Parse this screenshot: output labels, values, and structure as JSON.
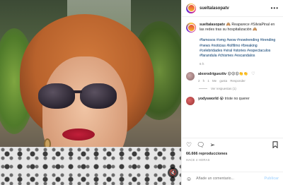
{
  "post": {
    "username": "sueltalasopatv",
    "caption_text": "🙈 Reaparece #SilviaPinal en las redes tras su hospitalización 🙈",
    "hashtags": "#famosos #omg #wow #nowtrending #trending #news #noticias #lolfilmo #breaking #celebridades #viral #stories #espectaculos #farandula #chismes #escandalos",
    "age": "6 h"
  },
  "comments": [
    {
      "username": "alexrodriguezttv",
      "text": "😍😍😍👏👏",
      "age": "2 h",
      "likes": "1 Me gusta",
      "reply": "Responder",
      "replies_label": "Ver respuestas (1)"
    },
    {
      "username": "yodysworld",
      "text": "😭 triste no querer"
    }
  ],
  "stats": {
    "views": "66.666 reproducciones",
    "time_ago": "HACE 4 HORAS"
  },
  "add_comment": {
    "placeholder": "Añade un comentario...",
    "publish_label": "Publicar"
  },
  "icons": {
    "more": "more-options-icon",
    "heart": "heart-icon",
    "comment": "comment-icon",
    "share": "share-icon",
    "bookmark": "bookmark-icon",
    "emoji": "emoji-icon",
    "mute": "mute-icon"
  }
}
